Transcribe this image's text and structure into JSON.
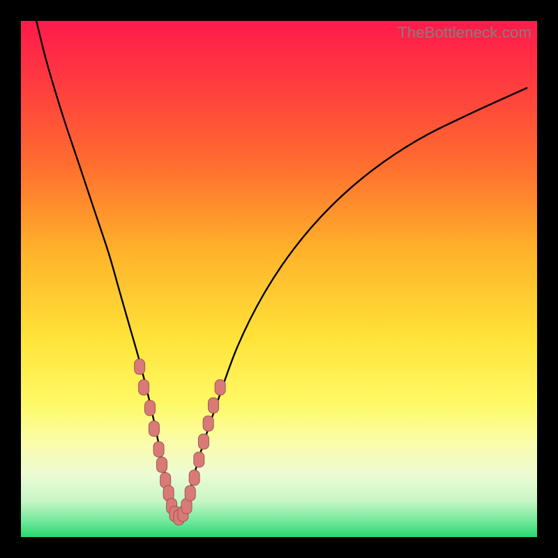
{
  "watermark": {
    "text": "TheBottleneck.com"
  },
  "colors": {
    "black": "#000000",
    "curve": "#000000",
    "marker_fill": "#d97a77",
    "marker_stroke": "#a05452",
    "gradient_stops": [
      {
        "offset": 0.0,
        "color": "#ff1a4b"
      },
      {
        "offset": 0.12,
        "color": "#ff3b3f"
      },
      {
        "offset": 0.28,
        "color": "#ff6e2f"
      },
      {
        "offset": 0.45,
        "color": "#ffb42a"
      },
      {
        "offset": 0.62,
        "color": "#ffe43a"
      },
      {
        "offset": 0.74,
        "color": "#fff966"
      },
      {
        "offset": 0.82,
        "color": "#fafdac"
      },
      {
        "offset": 0.88,
        "color": "#ecfbd4"
      },
      {
        "offset": 0.93,
        "color": "#c8f6c6"
      },
      {
        "offset": 0.97,
        "color": "#6fe89a"
      },
      {
        "offset": 1.0,
        "color": "#28d76f"
      }
    ]
  },
  "chart_data": {
    "type": "line",
    "title": "",
    "xlabel": "",
    "ylabel": "",
    "xlim": [
      0,
      100
    ],
    "ylim": [
      0,
      100
    ],
    "series": [
      {
        "name": "bottleneck-curve",
        "x": [
          3,
          5,
          8,
          11,
          14,
          17,
          19,
          21,
          23,
          25,
          26.5,
          28,
          29,
          30,
          31,
          32,
          33,
          35,
          38,
          42,
          47,
          53,
          60,
          68,
          77,
          87,
          98
        ],
        "y": [
          100,
          92,
          82,
          73,
          64,
          55,
          48,
          41,
          34,
          26,
          19,
          12,
          7,
          3.5,
          3.5,
          6,
          10,
          17,
          26,
          37,
          47,
          56,
          64,
          71,
          77,
          82,
          87
        ]
      }
    ],
    "markers": {
      "name": "highlight-points",
      "points": [
        {
          "x": 23.0,
          "y": 33
        },
        {
          "x": 23.8,
          "y": 29
        },
        {
          "x": 25.0,
          "y": 25
        },
        {
          "x": 25.8,
          "y": 21
        },
        {
          "x": 26.7,
          "y": 17
        },
        {
          "x": 27.3,
          "y": 14
        },
        {
          "x": 28.0,
          "y": 11
        },
        {
          "x": 28.6,
          "y": 8.5
        },
        {
          "x": 29.2,
          "y": 6.0
        },
        {
          "x": 29.8,
          "y": 4.5
        },
        {
          "x": 30.6,
          "y": 3.8
        },
        {
          "x": 31.4,
          "y": 4.5
        },
        {
          "x": 32.1,
          "y": 6.0
        },
        {
          "x": 32.8,
          "y": 8.5
        },
        {
          "x": 33.6,
          "y": 11.5
        },
        {
          "x": 34.5,
          "y": 15
        },
        {
          "x": 35.4,
          "y": 18.5
        },
        {
          "x": 36.3,
          "y": 22
        },
        {
          "x": 37.3,
          "y": 25.5
        },
        {
          "x": 38.6,
          "y": 29
        }
      ]
    }
  }
}
